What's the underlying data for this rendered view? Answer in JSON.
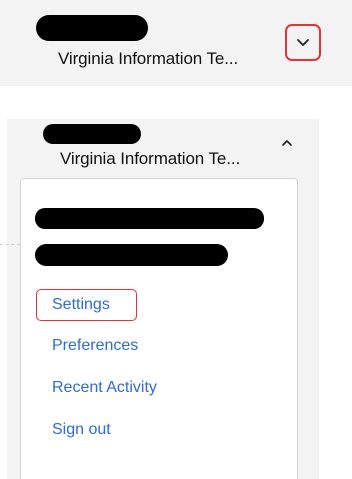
{
  "collapsed_header": {
    "org_name": "Virginia Information Te...",
    "chevron_icon": "chevron-down-icon",
    "highlight_color": "#e0343b"
  },
  "expanded_header": {
    "org_name": "Virginia Information Te...",
    "chevron_icon": "chevron-up-icon"
  },
  "menu": {
    "items": [
      {
        "label": "Settings"
      },
      {
        "label": "Preferences"
      },
      {
        "label": "Recent Activity"
      },
      {
        "label": "Sign out"
      }
    ],
    "link_color": "#2f6bd1"
  }
}
